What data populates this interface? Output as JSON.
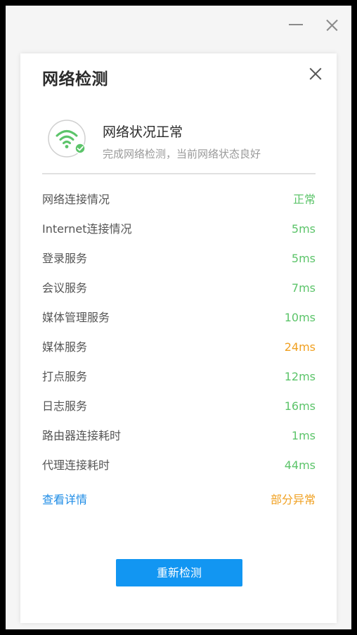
{
  "dialog": {
    "title": "网络检测"
  },
  "status": {
    "title": "网络状况正常",
    "subtitle": "完成网络检测，当前网络状态良好",
    "icon": "wifi-check-icon",
    "icon_color": "#5cc46a"
  },
  "colors": {
    "ok": "#5cc46a",
    "warn": "#f0a020",
    "link": "#1e8ce6",
    "button": "#1296f2"
  },
  "rows": [
    {
      "label": "网络连接情况",
      "value": "正常",
      "level": "ok"
    },
    {
      "label": "Internet连接情况",
      "value": "5ms",
      "level": "ok"
    },
    {
      "label": "登录服务",
      "value": "5ms",
      "level": "ok"
    },
    {
      "label": "会议服务",
      "value": "7ms",
      "level": "ok"
    },
    {
      "label": "媒体管理服务",
      "value": "10ms",
      "level": "ok"
    },
    {
      "label": "媒体服务",
      "value": "24ms",
      "level": "warn"
    },
    {
      "label": "打点服务",
      "value": "12ms",
      "level": "ok"
    },
    {
      "label": "日志服务",
      "value": "16ms",
      "level": "ok"
    },
    {
      "label": "路由器连接耗时",
      "value": "1ms",
      "level": "ok"
    },
    {
      "label": "代理连接耗时",
      "value": "44ms",
      "level": "ok"
    }
  ],
  "footer": {
    "details_link": "查看详情",
    "overall_status": "部分异常",
    "retest_button": "重新检测"
  }
}
